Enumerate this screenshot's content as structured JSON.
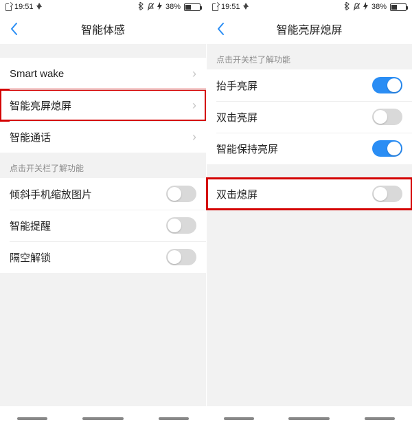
{
  "statusbar": {
    "time": "19:51",
    "battery_pct": "38%"
  },
  "left": {
    "title": "智能体感",
    "section1": {
      "smartwake": "Smart wake",
      "brightscreen": "智能亮屏熄屏",
      "smartcall": "智能通话"
    },
    "hint": "点击开关栏了解功能",
    "section2": {
      "tilt_zoom": "倾斜手机缩放图片",
      "smart_remind": "智能提醒",
      "air_unlock": "隔空解锁"
    }
  },
  "right": {
    "title": "智能亮屏熄屏",
    "hint": "点击开关栏了解功能",
    "section1": {
      "raise_wake": "抬手亮屏",
      "doubletap_wake": "双击亮屏",
      "keep_bright": "智能保持亮屏"
    },
    "section2": {
      "doubletap_off": "双击熄屏"
    }
  }
}
